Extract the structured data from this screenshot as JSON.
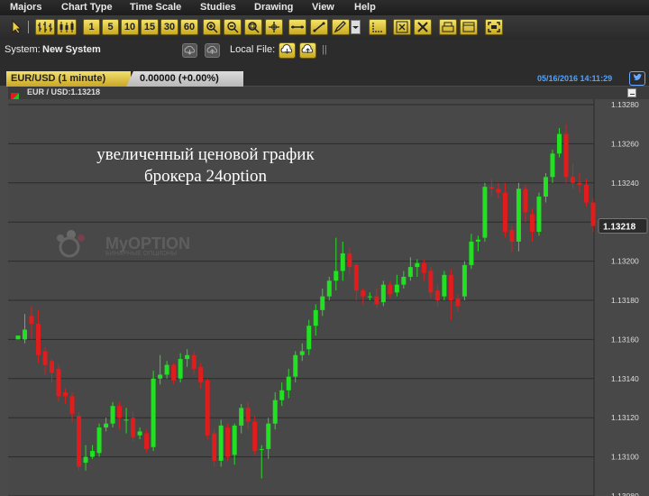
{
  "menu": {
    "items": [
      "Majors",
      "Chart Type",
      "Time Scale",
      "Drawing",
      "Studies",
      "View",
      "Help"
    ]
  },
  "toolbar": {
    "timescale_buttons": [
      "1",
      "5",
      "10",
      "15",
      "30",
      "60"
    ]
  },
  "system": {
    "label": "System:",
    "value": "New System",
    "local_file_label": "Local File:",
    "separator": "||"
  },
  "tabs": {
    "symbol_tab": "EUR/USD (1 minute)",
    "change_tab": "0.00000 (+0.00%)"
  },
  "header": {
    "datetime": "05/16/2016 14:11:29"
  },
  "legend": {
    "text": "EUR / USD:1.13218"
  },
  "annotation": {
    "line1": "увеличенный ценовой график",
    "line2": "брокера 24option"
  },
  "watermark": {
    "brand": "MyOPTION",
    "tagline": "БИНАРНЫЕ ОПЦИОНЫ"
  },
  "colors": {
    "up": "#22e022",
    "down": "#e01c1c",
    "grid": "#2a2a2a",
    "date": "#4fa3ff",
    "toolbar_button": "#e0c440"
  },
  "chart_data": {
    "type": "candlestick",
    "symbol": "EUR/USD",
    "interval": "1 minute",
    "current_price": "1.13218",
    "y_ticks": [
      "1.13280",
      "1.13260",
      "1.13240",
      "1.13220",
      "1.13200",
      "1.13180",
      "1.13160",
      "1.13140",
      "1.13120",
      "1.13100",
      "1.13080"
    ],
    "ylim": [
      1.13077,
      1.13283
    ],
    "y_tick_values": [
      1.1328,
      1.1326,
      1.1324,
      1.1322,
      1.132,
      1.1318,
      1.1316,
      1.1314,
      1.1312,
      1.131,
      1.1308
    ],
    "candles": [
      [
        1.1316,
        1.13162,
        1.1316,
        1.1316
      ],
      [
        1.1316,
        1.13165,
        1.13173,
        1.13158
      ],
      [
        1.13172,
        1.13168,
        1.13177,
        1.1316
      ],
      [
        1.13168,
        1.13152,
        1.13175,
        1.13148
      ],
      [
        1.13154,
        1.13147,
        1.13156,
        1.13142
      ],
      [
        1.13149,
        1.13143,
        1.1315,
        1.13138
      ],
      [
        1.13145,
        1.13131,
        1.13147,
        1.13128
      ],
      [
        1.13133,
        1.13131,
        1.13135,
        1.13127
      ],
      [
        1.13131,
        1.13122,
        1.13133,
        1.13118
      ],
      [
        1.13121,
        1.13095,
        1.13123,
        1.13093
      ],
      [
        1.13097,
        1.131,
        1.13106,
        1.13093
      ],
      [
        1.131,
        1.13103,
        1.13106,
        1.13099
      ],
      [
        1.13102,
        1.13115,
        1.13117,
        1.131
      ],
      [
        1.13115,
        1.13117,
        1.1312,
        1.13113
      ],
      [
        1.13117,
        1.13126,
        1.13128,
        1.13115
      ],
      [
        1.13126,
        1.1312,
        1.13128,
        1.13114
      ],
      [
        1.13119,
        1.13119,
        1.13125,
        1.13112
      ],
      [
        1.1312,
        1.1311,
        1.13123,
        1.13108
      ],
      [
        1.13111,
        1.13113,
        1.13115,
        1.13109
      ],
      [
        1.13112,
        1.13104,
        1.13114,
        1.13102
      ],
      [
        1.13105,
        1.1314,
        1.13144,
        1.13103
      ],
      [
        1.1314,
        1.13142,
        1.13152,
        1.13137
      ],
      [
        1.13142,
        1.13147,
        1.13149,
        1.1314
      ],
      [
        1.13147,
        1.13139,
        1.13148,
        1.13137
      ],
      [
        1.1314,
        1.1315,
        1.13153,
        1.13138
      ],
      [
        1.1315,
        1.13152,
        1.13155,
        1.13146
      ],
      [
        1.13152,
        1.13145,
        1.13154,
        1.13142
      ],
      [
        1.13146,
        1.13138,
        1.13148,
        1.13135
      ],
      [
        1.13139,
        1.13111,
        1.1314,
        1.13109
      ],
      [
        1.13112,
        1.13098,
        1.13114,
        1.13095
      ],
      [
        1.13098,
        1.13116,
        1.13119,
        1.13095
      ],
      [
        1.13115,
        1.131,
        1.13117,
        1.13098
      ],
      [
        1.13101,
        1.13116,
        1.13117,
        1.13096
      ],
      [
        1.13116,
        1.13125,
        1.13127,
        1.13112
      ],
      [
        1.13125,
        1.13118,
        1.13128,
        1.13114
      ],
      [
        1.13118,
        1.13103,
        1.13121,
        1.13101
      ],
      [
        1.13104,
        1.13104,
        1.13106,
        1.13089
      ],
      [
        1.13104,
        1.13117,
        1.1312,
        1.13099
      ],
      [
        1.13117,
        1.13129,
        1.13133,
        1.13114
      ],
      [
        1.13129,
        1.13134,
        1.13138,
        1.13126
      ],
      [
        1.13134,
        1.13141,
        1.13145,
        1.1313
      ],
      [
        1.13141,
        1.13152,
        1.13154,
        1.13138
      ],
      [
        1.13152,
        1.13154,
        1.13158,
        1.13149
      ],
      [
        1.13155,
        1.13167,
        1.1317,
        1.13152
      ],
      [
        1.13167,
        1.13175,
        1.13178,
        1.13162
      ],
      [
        1.13175,
        1.13182,
        1.13186,
        1.13172
      ],
      [
        1.13182,
        1.1319,
        1.13192,
        1.1318
      ],
      [
        1.1319,
        1.13195,
        1.13212,
        1.13185
      ],
      [
        1.13195,
        1.13204,
        1.1321,
        1.1319
      ],
      [
        1.13204,
        1.13197,
        1.13207,
        1.13193
      ],
      [
        1.13198,
        1.13185,
        1.13199,
        1.1318
      ],
      [
        1.13185,
        1.13182,
        1.13186,
        1.13178
      ],
      [
        1.13182,
        1.13182,
        1.13184,
        1.1318
      ],
      [
        1.13182,
        1.13178,
        1.13186,
        1.13176
      ],
      [
        1.13179,
        1.13188,
        1.1319,
        1.13177
      ],
      [
        1.13188,
        1.13183,
        1.1319,
        1.13181
      ],
      [
        1.13184,
        1.13188,
        1.13193,
        1.13182
      ],
      [
        1.13188,
        1.13192,
        1.13195,
        1.13186
      ],
      [
        1.13192,
        1.13197,
        1.13202,
        1.1319
      ],
      [
        1.13197,
        1.13199,
        1.13201,
        1.13192
      ],
      [
        1.13199,
        1.13194,
        1.13201,
        1.1319
      ],
      [
        1.13195,
        1.13184,
        1.13197,
        1.13181
      ],
      [
        1.13185,
        1.1318,
        1.13188,
        1.13177
      ],
      [
        1.13182,
        1.13193,
        1.13195,
        1.1318
      ],
      [
        1.13193,
        1.1318,
        1.13196,
        1.1317
      ],
      [
        1.13181,
        1.13177,
        1.13183,
        1.13174
      ],
      [
        1.13182,
        1.13198,
        1.132,
        1.1318
      ],
      [
        1.13198,
        1.1321,
        1.13214,
        1.13196
      ],
      [
        1.1321,
        1.13211,
        1.13213,
        1.13205
      ],
      [
        1.13212,
        1.13238,
        1.1324,
        1.1321
      ],
      [
        1.13238,
        1.13237,
        1.13242,
        1.13233
      ],
      [
        1.13237,
        1.13235,
        1.1324,
        1.13232
      ],
      [
        1.13235,
        1.13215,
        1.1324,
        1.13212
      ],
      [
        1.13216,
        1.1321,
        1.13218,
        1.13205
      ],
      [
        1.1321,
        1.13237,
        1.1324,
        1.13205
      ],
      [
        1.13237,
        1.13225,
        1.13239,
        1.1322
      ],
      [
        1.13224,
        1.13215,
        1.13227,
        1.1321
      ],
      [
        1.13215,
        1.13233,
        1.13235,
        1.13213
      ],
      [
        1.13233,
        1.13243,
        1.13245,
        1.1323
      ],
      [
        1.13243,
        1.13255,
        1.13257,
        1.1324
      ],
      [
        1.13255,
        1.13265,
        1.13268,
        1.13253
      ],
      [
        1.13265,
        1.13243,
        1.1327,
        1.1324
      ],
      [
        1.13243,
        1.1324,
        1.1325,
        1.13237
      ],
      [
        1.1324,
        1.13239,
        1.13245,
        1.13235
      ],
      [
        1.13239,
        1.1323,
        1.13242,
        1.13228
      ],
      [
        1.1323,
        1.13218,
        1.13232,
        1.13215
      ]
    ]
  }
}
